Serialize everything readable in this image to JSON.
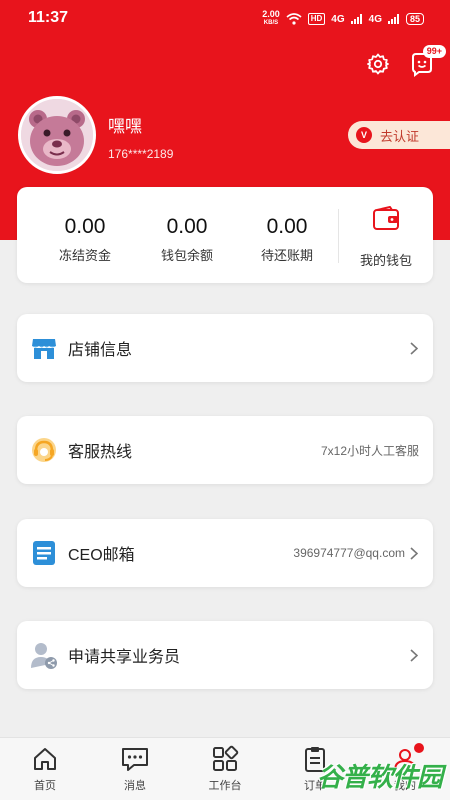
{
  "status_bar": {
    "time": "11:37",
    "net_speed": "2.00",
    "net_unit": "KB/S",
    "hd": "HD",
    "signal1": "4G",
    "signal2": "4G",
    "battery": "85"
  },
  "header": {
    "settings_icon": "gear-icon",
    "message_icon": "message-face-icon",
    "message_badge": "99+"
  },
  "user": {
    "name": "嘿嘿",
    "phone": "176****2189",
    "verify_label": "去认证",
    "verify_icon_text": "V"
  },
  "wallet": {
    "stats": [
      {
        "value": "0.00",
        "label": "冻结资金"
      },
      {
        "value": "0.00",
        "label": "钱包余额"
      },
      {
        "value": "0.00",
        "label": "待还账期"
      }
    ],
    "link_label": "我的钱包"
  },
  "menu": {
    "shop": {
      "label": "店铺信息",
      "value": ""
    },
    "service": {
      "label": "客服热线",
      "value": "7x12小时人工客服"
    },
    "ceo": {
      "label": "CEO邮箱",
      "value": "396974777@qq.com"
    },
    "apply": {
      "label": "申请共享业务员",
      "value": ""
    }
  },
  "tabs": [
    {
      "label": "首页",
      "icon": "home-icon"
    },
    {
      "label": "消息",
      "icon": "chat-icon"
    },
    {
      "label": "工作台",
      "icon": "grid-icon"
    },
    {
      "label": "订单",
      "icon": "clipboard-icon"
    },
    {
      "label": "我的",
      "icon": "profile-icon"
    }
  ],
  "watermark": "谷普软件园",
  "colors": {
    "brand_red": "#e8141c",
    "accent_blue": "#2d8fd8",
    "accent_orange": "#f5a623"
  }
}
